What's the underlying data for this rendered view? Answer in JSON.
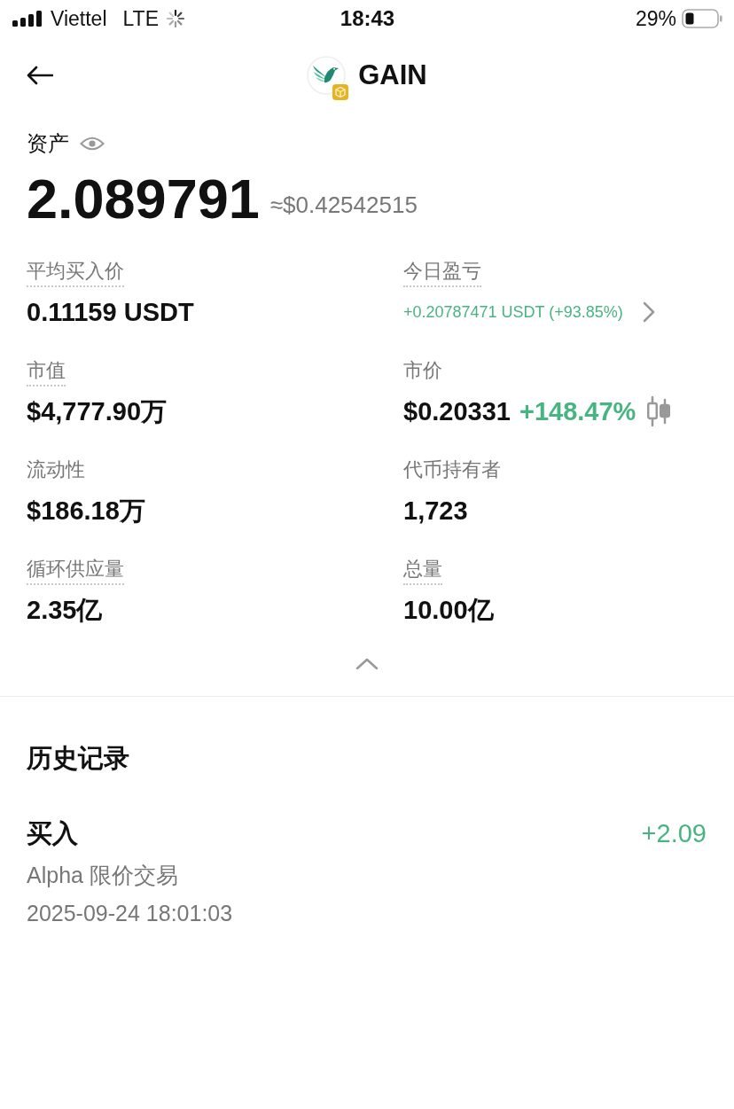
{
  "status_bar": {
    "carrier": "Viettel",
    "network": "LTE",
    "time": "18:43",
    "battery": "29%"
  },
  "header": {
    "title": "GAIN"
  },
  "assets": {
    "label": "资产",
    "amount": "2.089791",
    "approx_value": "≈$0.42542515"
  },
  "stats": [
    {
      "label": "平均买入价",
      "underlined": true,
      "kind": "plain",
      "value": "0.11159 USDT"
    },
    {
      "label": "今日盈亏",
      "underlined": true,
      "kind": "pnl",
      "value": "+0.20787471 USDT (+93.85%)"
    },
    {
      "label": "市值",
      "underlined": true,
      "kind": "plain",
      "value": "$4,777.90万"
    },
    {
      "label": "市价",
      "underlined": false,
      "kind": "price",
      "value": "$0.20331",
      "change": "+148.47%"
    },
    {
      "label": "流动性",
      "underlined": false,
      "kind": "plain",
      "value": "$186.18万"
    },
    {
      "label": "代币持有者",
      "underlined": false,
      "kind": "plain",
      "value": "1,723"
    },
    {
      "label": "循环供应量",
      "underlined": true,
      "kind": "plain",
      "value": "2.35亿"
    },
    {
      "label": "总量",
      "underlined": true,
      "kind": "plain",
      "value": "10.00亿"
    }
  ],
  "history": {
    "title": "历史记录",
    "items": [
      {
        "type": "买入",
        "amount": "+2.09",
        "description": "Alpha 限价交易",
        "time": "2025-09-24 18:01:03"
      }
    ]
  }
}
